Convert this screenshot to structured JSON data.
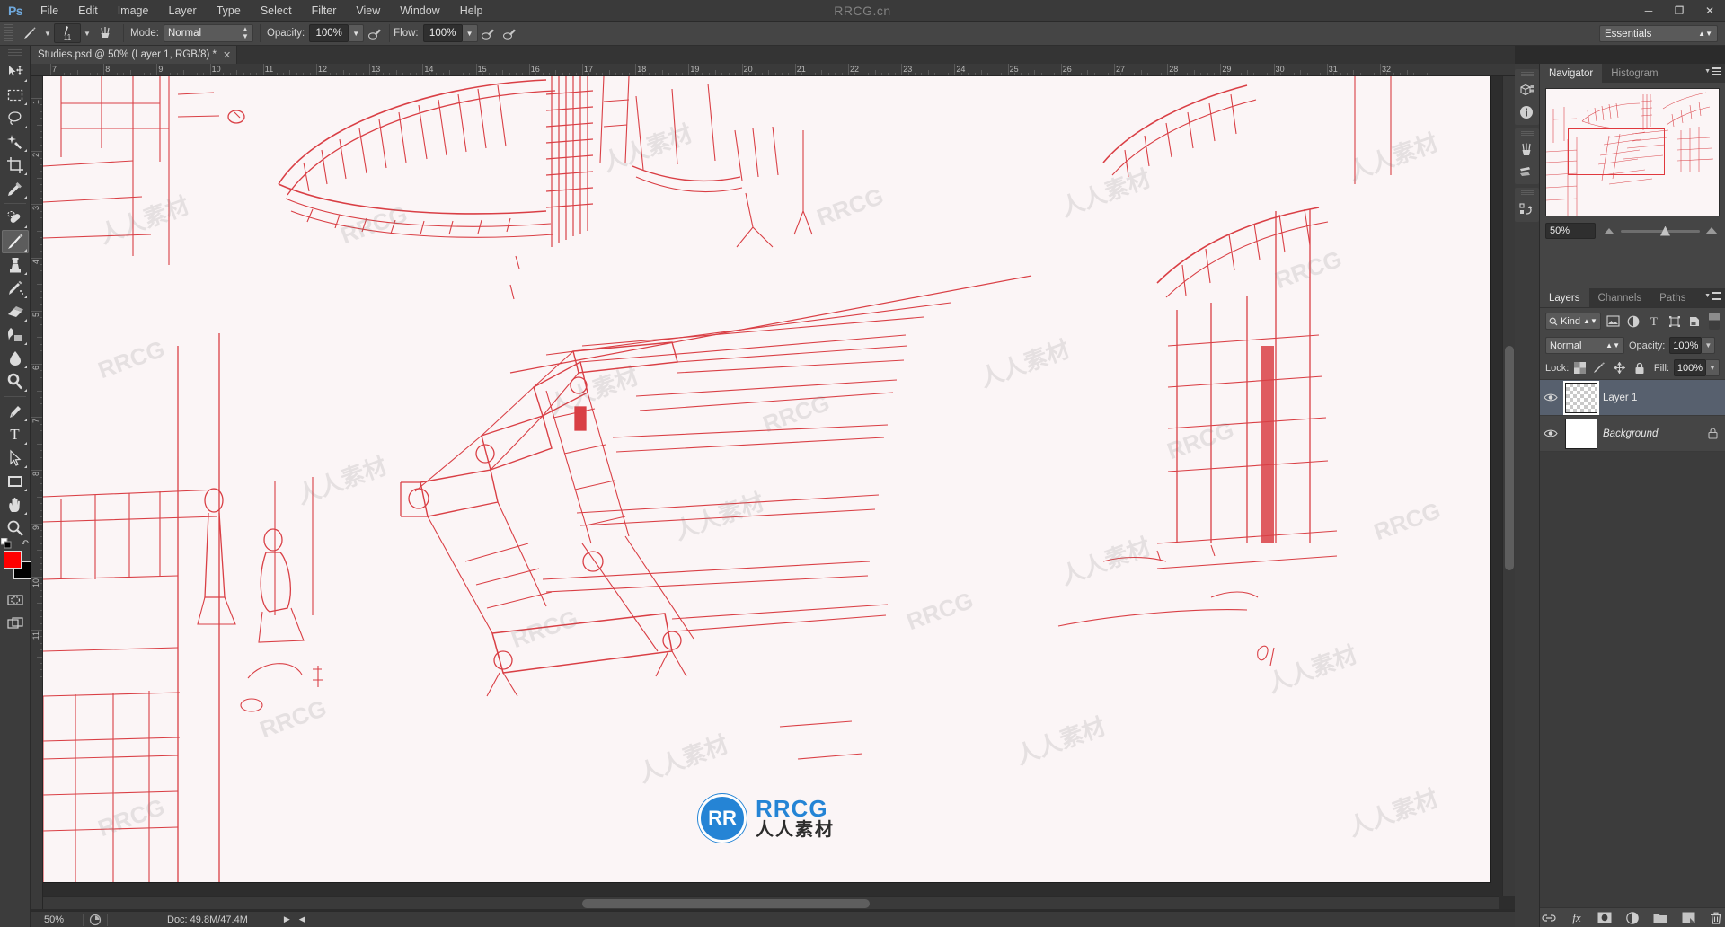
{
  "app": {
    "name": "Ps",
    "window_watermark": "RRCG.cn",
    "window_controls": [
      "minimize",
      "restore",
      "close"
    ]
  },
  "menubar": {
    "items": [
      "File",
      "Edit",
      "Image",
      "Layer",
      "Type",
      "Select",
      "Filter",
      "View",
      "Window",
      "Help"
    ]
  },
  "options_bar": {
    "tool_icon": "brush-icon",
    "brush_size": "11",
    "brush_panel_icon": "brush-panel-icon",
    "mode_label": "Mode:",
    "mode_value": "Normal",
    "opacity_label": "Opacity:",
    "opacity_value": "100%",
    "opacity_pressure_icon": "pressure-opacity-icon",
    "flow_label": "Flow:",
    "flow_value": "100%",
    "airbrush_icon": "airbrush-icon",
    "smoothing_icon": "smoothing-icon",
    "workspace": "Essentials"
  },
  "document_tab": {
    "title": "Studies.psd @ 50% (Layer 1, RGB/8) *",
    "close_icon": "close-icon"
  },
  "toolbar": {
    "tools": [
      {
        "name": "move-tool",
        "icon": "move-icon",
        "selected": false,
        "has_flyout": true
      },
      {
        "name": "marquee-tool",
        "icon": "rectangular-marquee-icon",
        "selected": false,
        "has_flyout": true
      },
      {
        "name": "lasso-tool",
        "icon": "lasso-icon",
        "selected": false,
        "has_flyout": true
      },
      {
        "name": "quick-selection-tool",
        "icon": "magic-wand-icon",
        "selected": false,
        "has_flyout": true
      },
      {
        "name": "crop-tool",
        "icon": "crop-icon",
        "selected": false,
        "has_flyout": true
      },
      {
        "name": "eyedropper-tool",
        "icon": "eyedropper-icon",
        "selected": false,
        "has_flyout": true
      },
      {
        "name": "healing-brush-tool",
        "icon": "healing-brush-icon",
        "selected": false,
        "has_flyout": true
      },
      {
        "name": "brush-tool",
        "icon": "brush-icon",
        "selected": true,
        "has_flyout": true
      },
      {
        "name": "clone-stamp-tool",
        "icon": "clone-stamp-icon",
        "selected": false,
        "has_flyout": true
      },
      {
        "name": "history-brush-tool",
        "icon": "history-brush-icon",
        "selected": false,
        "has_flyout": true
      },
      {
        "name": "eraser-tool",
        "icon": "eraser-icon",
        "selected": false,
        "has_flyout": true
      },
      {
        "name": "gradient-tool",
        "icon": "gradient-icon",
        "selected": false,
        "has_flyout": true
      },
      {
        "name": "blur-tool",
        "icon": "blur-drop-icon",
        "selected": false,
        "has_flyout": true
      },
      {
        "name": "dodge-tool",
        "icon": "dodge-icon",
        "selected": false,
        "has_flyout": true
      },
      {
        "name": "pen-tool",
        "icon": "pen-icon",
        "selected": false,
        "has_flyout": true
      },
      {
        "name": "type-tool",
        "icon": "type-t-icon",
        "selected": false,
        "has_flyout": true
      },
      {
        "name": "path-selection-tool",
        "icon": "path-arrow-icon",
        "selected": false,
        "has_flyout": true
      },
      {
        "name": "rectangle-tool",
        "icon": "rectangle-shape-icon",
        "selected": false,
        "has_flyout": true
      },
      {
        "name": "hand-tool",
        "icon": "hand-icon",
        "selected": false,
        "has_flyout": true
      },
      {
        "name": "zoom-tool",
        "icon": "zoom-magnifier-icon",
        "selected": false,
        "has_flyout": false
      }
    ],
    "edit_toolbar_icon": "edit-toolbar-dots-icon",
    "swap_colors_icon": "swap-colors-icon",
    "foreground_color": "#ff0000",
    "background_color": "#000000",
    "quick_mask_icon": "quick-mask-icon",
    "screen_mode_icon": "screen-mode-icon"
  },
  "rulers": {
    "unit": "inches",
    "h_labels": [
      "7",
      "8",
      "9",
      "10",
      "11",
      "12",
      "13",
      "14",
      "15",
      "16",
      "17",
      "18",
      "19",
      "20",
      "21",
      "22",
      "23",
      "24",
      "25",
      "26",
      "27",
      "28",
      "29",
      "30",
      "31",
      "32"
    ],
    "v_labels": [
      "1",
      "2",
      "3",
      "4",
      "5",
      "6",
      "7",
      "8",
      "9",
      "10",
      "11"
    ]
  },
  "canvas": {
    "paper_color": "#fbf5f6",
    "artwork_ink": "#d8363c",
    "watermark_text_en": "RRCG",
    "watermark_text_cn": "人人素材",
    "logo_mark": "RR",
    "logo_title": "RRCG",
    "logo_subtitle": "人人素材"
  },
  "status_bar": {
    "zoom": "50%",
    "doc_icon": "document-icon",
    "doc_info": "Doc: 49.8M/47.4M",
    "play_icon": "play-arrow-icon",
    "prev_icon": "left-arrow-icon"
  },
  "dock_icons": [
    {
      "name": "3d-panel-icon",
      "icon": "cube-icon"
    },
    {
      "name": "info-panel-icon",
      "icon": "info-circle-icon"
    },
    {
      "name": "brushes-panel-icon",
      "icon": "brush-tip-icon"
    },
    {
      "name": "brush-settings-panel-icon",
      "icon": "brush-settings-icon"
    },
    {
      "name": "history-panel-icon",
      "icon": "history-undo-icon"
    }
  ],
  "navigator_panel": {
    "tabs": [
      {
        "label": "Navigator",
        "active": true
      },
      {
        "label": "Histogram",
        "active": false
      }
    ],
    "menu_icon": "panel-menu-icon",
    "zoom_value": "50%",
    "zoom_out_icon": "zoom-out-small-icon",
    "zoom_in_icon": "zoom-in-large-icon"
  },
  "layers_panel": {
    "tabs": [
      {
        "label": "Layers",
        "active": true
      },
      {
        "label": "Channels",
        "active": false
      },
      {
        "label": "Paths",
        "active": false
      }
    ],
    "menu_icon": "panel-menu-icon",
    "filter": {
      "search_icon": "search-icon",
      "kind_label": "Kind",
      "icons": [
        "pixel-layer-filter-icon",
        "adjustment-layer-filter-icon",
        "type-layer-filter-icon",
        "shape-layer-filter-icon",
        "smart-object-filter-icon"
      ],
      "toggle_icon": "filter-toggle-icon"
    },
    "blend_mode": "Normal",
    "opacity_label": "Opacity:",
    "opacity_value": "100%",
    "lock_label": "Lock:",
    "lock_icons": [
      "lock-transparent-pixels-icon",
      "lock-image-pixels-icon",
      "lock-position-icon",
      "lock-all-icon"
    ],
    "fill_label": "Fill:",
    "fill_value": "100%",
    "layers": [
      {
        "name": "Layer 1",
        "visible": true,
        "selected": true,
        "locked": false,
        "italic": false,
        "thumb": "transparent-checker"
      },
      {
        "name": "Background",
        "visible": true,
        "selected": false,
        "locked": true,
        "italic": true,
        "thumb": "white"
      }
    ],
    "footer_icons": [
      {
        "name": "link-layers-button",
        "icon": "link-icon"
      },
      {
        "name": "layer-style-button",
        "icon": "fx-icon"
      },
      {
        "name": "add-layer-mask-button",
        "icon": "mask-circle-icon"
      },
      {
        "name": "adjustment-layer-button",
        "icon": "half-circle-icon"
      },
      {
        "name": "new-group-button",
        "icon": "folder-icon"
      },
      {
        "name": "new-layer-button",
        "icon": "new-layer-icon"
      },
      {
        "name": "delete-layer-button",
        "icon": "trash-icon"
      }
    ]
  }
}
